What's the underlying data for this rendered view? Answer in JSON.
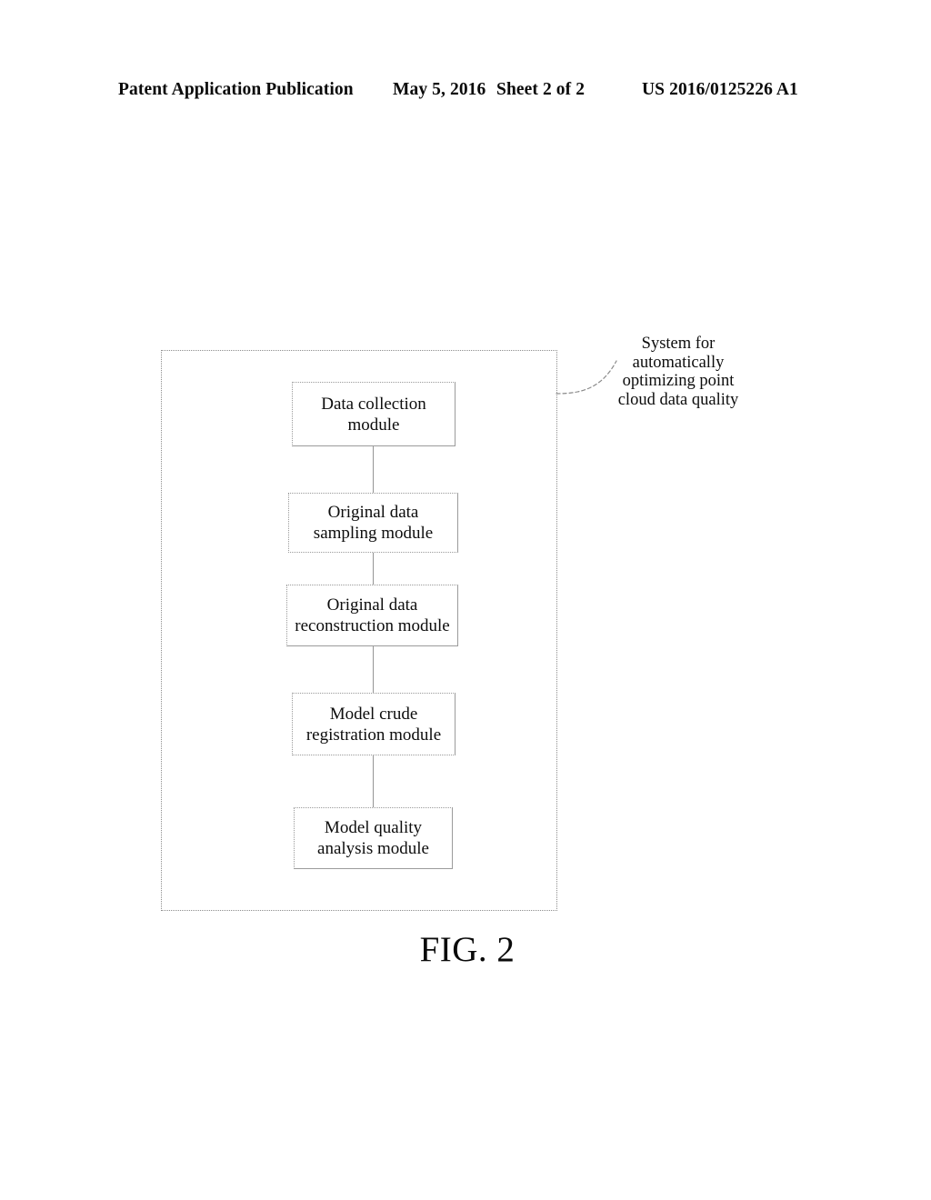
{
  "page": {
    "background_color": "#ffffff",
    "ink_color": "#000000"
  },
  "header": {
    "publication": "Patent Application Publication",
    "date": "May 5, 2016",
    "sheet": "Sheet 2 of 2",
    "patent_number": "US 2016/0125226 A1"
  },
  "figure": {
    "caption": "FIG. 2",
    "annotation": {
      "label": "System for\nautomatically\noptimizing point\ncloud data quality",
      "leader_line": "dashed-curve"
    },
    "container": {
      "name": "system-boundary",
      "border_style": "dotted",
      "border_color": "#8d8d8d"
    },
    "modules": [
      {
        "id": "data-collection",
        "label": "Data collection\nmodule"
      },
      {
        "id": "original-sampling",
        "label": "Original data\nsampling module"
      },
      {
        "id": "original-reconstruction",
        "label": "Original data\nreconstruction module"
      },
      {
        "id": "model-crude",
        "label": "Model crude\nregistration module"
      },
      {
        "id": "model-quality",
        "label": "Model quality\nanalysis module"
      }
    ],
    "connectors": [
      {
        "from": "data-collection",
        "to": "original-sampling"
      },
      {
        "from": "original-sampling",
        "to": "original-reconstruction"
      },
      {
        "from": "original-reconstruction",
        "to": "model-crude"
      },
      {
        "from": "model-crude",
        "to": "model-quality"
      }
    ]
  }
}
